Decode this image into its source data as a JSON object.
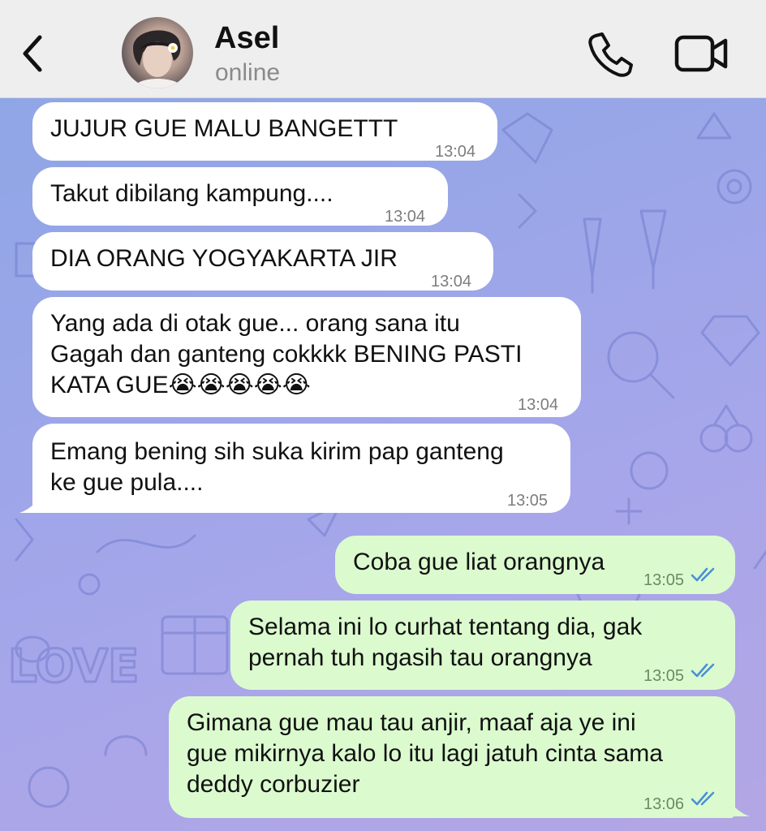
{
  "header": {
    "contact_name": "Asel",
    "status": "online",
    "icons": {
      "back": "chevron-left-icon",
      "call": "phone-icon",
      "video": "video-camera-icon",
      "avatar": "avatar"
    }
  },
  "messages": [
    {
      "dir": "incoming",
      "text": "JUJUR GUE MALU BANGETTT",
      "time": "13:04"
    },
    {
      "dir": "incoming",
      "text": "Takut dibilang kampung....",
      "time": "13:04"
    },
    {
      "dir": "incoming",
      "text": "DIA ORANG YOGYAKARTA JIR",
      "time": "13:04"
    },
    {
      "dir": "incoming",
      "text": "Yang ada di otak gue... orang sana itu\nGagah dan ganteng cokkkk BENING PASTI\nKATA GUE😭😭😭😭😭",
      "time": "13:04"
    },
    {
      "dir": "incoming",
      "text": "Emang bening sih suka kirim pap ganteng\nke gue pula....",
      "time": "13:05"
    },
    {
      "dir": "outgoing",
      "text": "Coba gue liat orangnya",
      "time": "13:05",
      "read": true
    },
    {
      "dir": "outgoing",
      "text": "Selama ini lo curhat tentang dia, gak\npernah tuh ngasih tau orangnya",
      "time": "13:05",
      "read": true
    },
    {
      "dir": "outgoing",
      "text": "Gimana gue mau tau anjir, maaf aja ye ini\ngue mikirnya kalo lo itu lagi jatuh cinta sama\ndeddy corbuzier",
      "time": "13:06",
      "read": true
    }
  ],
  "colors": {
    "incoming_bubble": "#ffffff",
    "outgoing_bubble": "#dbfbcf",
    "read_ticks": "#4a8fd8",
    "wallpaper_start": "#8fa6e6",
    "wallpaper_end": "#b3a6e4"
  }
}
